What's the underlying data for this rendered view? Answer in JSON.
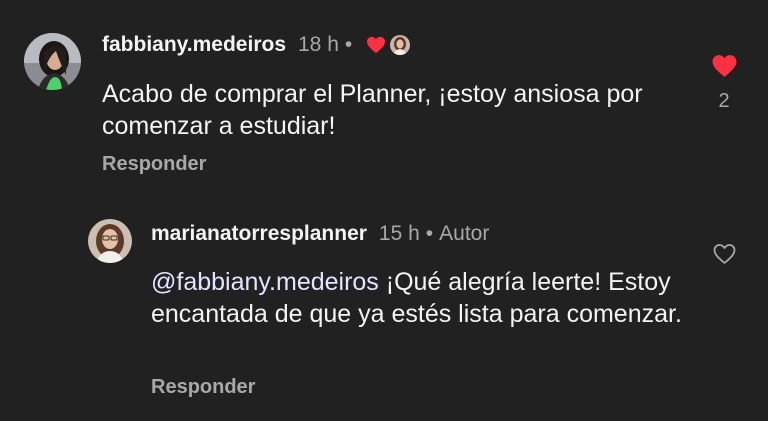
{
  "comment": {
    "username": "fabbiany.medeiros",
    "time": "18 h",
    "separator": "•",
    "text": "Acabo de comprar el Planner, ¡estoy ansiosa por comenzar a estudiar!",
    "reply_label": "Responder",
    "like_count": "2",
    "liked": true,
    "heart_color": "#ff3040"
  },
  "reply": {
    "username": "marianatorresplanner",
    "time": "15 h",
    "separator": "•",
    "author_label": "Autor",
    "mention": "@fabbiany.medeiros",
    "text": " ¡Qué alegría leerte! Estoy encantada de que ya estés lista para comenzar.",
    "reply_label": "Responder",
    "liked": false
  },
  "icons": {
    "liked_heart": "heart-filled-icon",
    "like_heart": "heart-outline-icon"
  },
  "colors": {
    "background": "#212121",
    "secondary_text": "#a8a8a8",
    "accent_red": "#ff3040"
  }
}
